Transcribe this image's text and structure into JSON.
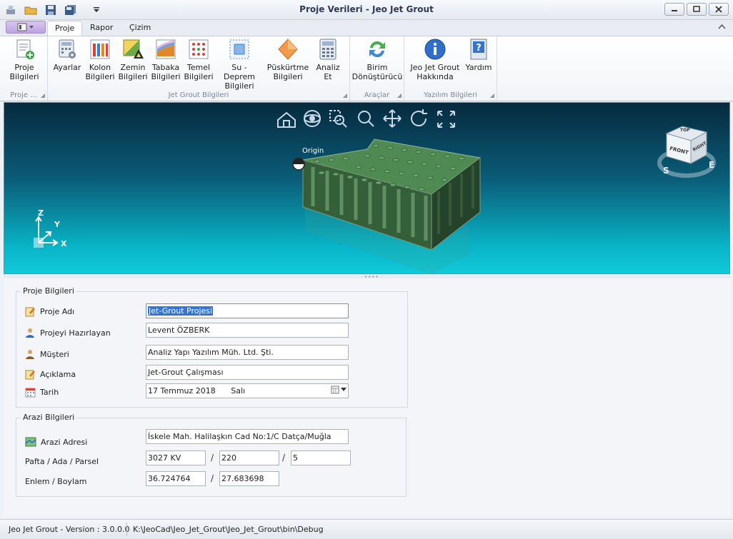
{
  "window": {
    "title": "Proje Verileri - Jeo Jet Grout",
    "controls": [
      "minimize",
      "maximize",
      "close"
    ]
  },
  "ribbon_tabs": [
    {
      "label": "Proje",
      "active": true
    },
    {
      "label": "Rapor",
      "active": false
    },
    {
      "label": "Çizim",
      "active": false
    }
  ],
  "ribbon_groups": [
    {
      "label": "Proje ...",
      "buttons": [
        {
          "label": "Proje\nBilgileri",
          "icon": "document-add-icon"
        }
      ]
    },
    {
      "label": "Jet Grout Bilgileri",
      "buttons": [
        {
          "label": "Ayarlar",
          "icon": "calculator-gear-icon"
        },
        {
          "label": "Kolon\nBilgileri",
          "icon": "columns-chart-icon"
        },
        {
          "label": "Zemin\nBilgileri",
          "icon": "soil-triangle-icon"
        },
        {
          "label": "Tabaka\nBilgileri",
          "icon": "layers-icon"
        },
        {
          "label": "Temel\nBilgileri",
          "icon": "dots-grid-icon"
        },
        {
          "label": "Su - Deprem\nBilgileri",
          "icon": "water-square-icon"
        },
        {
          "label": "Püskürtme\nBilgileri",
          "icon": "spray-diamond-icon"
        },
        {
          "label": "Analiz\nEt",
          "icon": "calculator-icon"
        }
      ]
    },
    {
      "label": "Araçlar",
      "buttons": [
        {
          "label": "Birim\nDönüştürücü",
          "icon": "refresh-icon"
        }
      ]
    },
    {
      "label": "Yazılım Bilgileri",
      "buttons": [
        {
          "label": "Jeo Jet Grout\nHakkında",
          "icon": "info-icon"
        },
        {
          "label": "Yardım",
          "icon": "help-icon"
        }
      ]
    }
  ],
  "viewport": {
    "origin_label": "Origin",
    "axis_labels": {
      "z": "Z",
      "y": "Y",
      "x": "X"
    },
    "viewcube": {
      "front": "FRONT",
      "right": "RIGHT",
      "top": "TOP",
      "compass_s": "S",
      "compass_e": "E"
    },
    "toolbar_icons": [
      "home-icon",
      "orbit-icon",
      "zoom-window-icon",
      "zoom-icon",
      "pan-icon",
      "rotate-icon",
      "fullscreen-icon"
    ]
  },
  "project_info": {
    "title": "Proje Bilgileri",
    "fields": [
      {
        "label": "Proje Adı",
        "value": "Jet-Grout Projesi"
      },
      {
        "label": "Projeyi Hazırlayan",
        "value": "Levent ÖZBERK"
      },
      {
        "label": "Müşteri",
        "value": "Analiz Yapı Yazılım Müh. Ltd. Şti."
      },
      {
        "label": "Açıklama",
        "value": "Jet-Grout Çalışması"
      }
    ],
    "date": {
      "label": "Tarih",
      "value": "17 Temmuz 2018",
      "weekday": "Salı"
    }
  },
  "land_info": {
    "title": "Arazi Bilgileri",
    "address": {
      "label": "Arazi Adresi",
      "value": "İskele Mah. Halilaşkın Cad No:1/C Datça/Muğla"
    },
    "parcel": {
      "label": "Pafta / Ada / Parsel",
      "pafta": "3027 KV",
      "ada": "220",
      "parsel": "5"
    },
    "coords": {
      "label": "Enlem / Boylam",
      "lat": "36.724764",
      "lon": "27.683698"
    },
    "separator": "/"
  },
  "status": {
    "version": "Jeo Jet Grout - Version : 3.0.0.0",
    "path": "K:\\JeoCad\\Jeo_Jet_Grout\\Jeo_Jet_Grout\\bin\\Debug"
  }
}
